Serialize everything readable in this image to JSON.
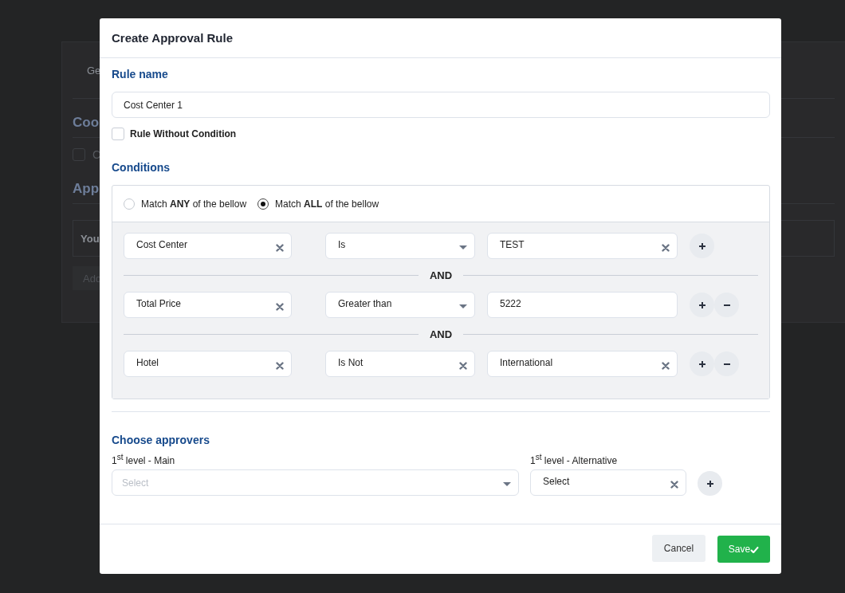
{
  "background_page": {
    "tab_label": "Ge",
    "section_heading": "Coo",
    "checkbox": {
      "label": "C",
      "checked": false
    },
    "list_heading": "App",
    "row_text": "You",
    "add_button": "Add"
  },
  "modal": {
    "title": "Create Approval Rule",
    "rule_name": {
      "label": "Rule name",
      "value": "Cost Center 1"
    },
    "rule_without_condition": {
      "label": "Rule Without Condition",
      "checked": false
    },
    "conditions": {
      "title": "Conditions",
      "match_options": [
        {
          "label": "Match **ANY** of the bellow",
          "selected": false
        },
        {
          "label": "Match **ALL** of the bellow",
          "selected": true
        }
      ],
      "rows": [
        {
          "fields": [
            {
              "kind": "clearable",
              "value": "Cost Center"
            },
            {
              "kind": "dropdown",
              "value": "Is"
            },
            {
              "kind": "clearable",
              "value": "TEST"
            }
          ],
          "removable": false
        },
        {
          "connector": "AND",
          "fields": [
            {
              "kind": "clearable",
              "value": "Total Price"
            },
            {
              "kind": "dropdown",
              "value": "Greater than"
            },
            {
              "kind": "text",
              "value": "5222"
            }
          ],
          "removable": true
        },
        {
          "connector": "AND",
          "fields": [
            {
              "kind": "clearable",
              "value": "Hotel"
            },
            {
              "kind": "clearable",
              "value": "Is Not"
            },
            {
              "kind": "clearable",
              "value": "International"
            }
          ],
          "removable": true
        }
      ]
    },
    "approvers": {
      "title": "Choose approvers",
      "levels": [
        {
          "label": "1$^{st}$ level - Main",
          "kind": "dropdown",
          "placeholder": "Select"
        },
        {
          "label": "1$^{st}$ level - Alternative",
          "kind": "clearable",
          "value": "Select"
        }
      ]
    },
    "footer_buttons": [
      {
        "kind": "secondary",
        "label": "Cancel"
      },
      {
        "kind": "primary",
        "label": "Save"
      }
    ]
  }
}
